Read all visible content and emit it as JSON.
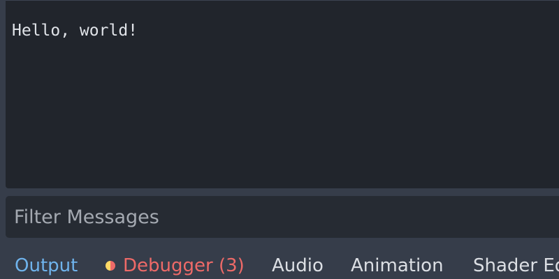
{
  "output": {
    "lines": [
      "Hello, world!"
    ]
  },
  "filter": {
    "placeholder": "Filter Messages",
    "value": ""
  },
  "tabs": [
    {
      "label": "Output",
      "state": "active"
    },
    {
      "label": "Debugger (3)",
      "state": "error",
      "icon": "half-warning-half-error-icon"
    },
    {
      "label": "Audio",
      "state": "normal"
    },
    {
      "label": "Animation",
      "state": "normal"
    },
    {
      "label": "Shader Editor",
      "state": "normal"
    }
  ],
  "colors": {
    "panel_bg": "#21252c",
    "editor_bg": "#363d4a",
    "text": "#e0e3e8",
    "accent_active": "#6fb3ec",
    "error": "#ee6a68",
    "warning": "#ffd966"
  }
}
